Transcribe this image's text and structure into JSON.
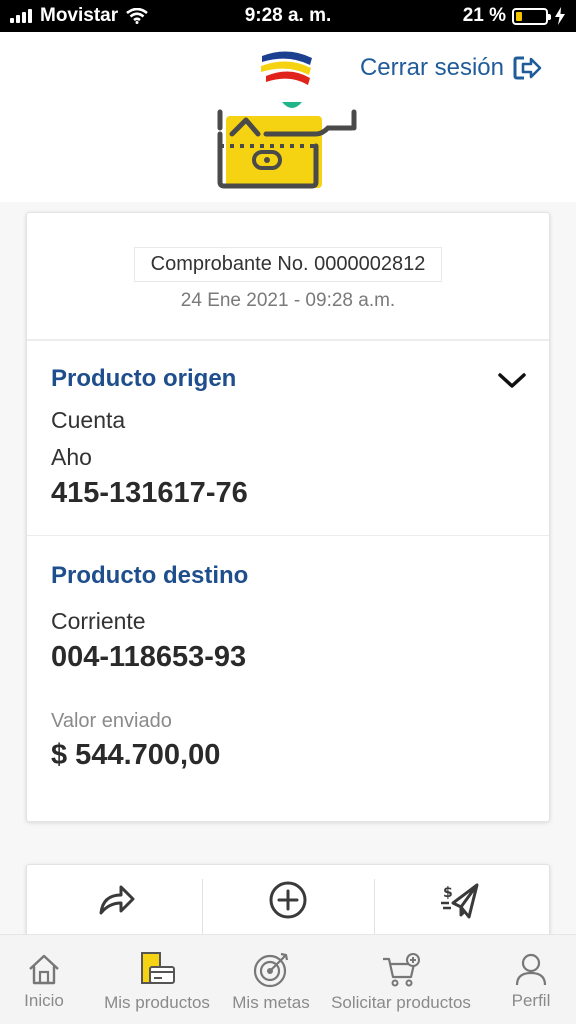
{
  "status_bar": {
    "carrier": "Movistar",
    "time": "9:28 a. m.",
    "battery": "21 %",
    "battery_level": 0.21
  },
  "header": {
    "logout_label": "Cerrar sesión"
  },
  "receipt": {
    "voucher": "Comprobante No. 0000002812",
    "date": "24 Ene 2021 - 09:28 a.m.",
    "origin": {
      "title": "Producto origen",
      "type_line1": "Cuenta",
      "type_line2": "Aho",
      "number": "415-131617-76"
    },
    "destination": {
      "title": "Producto destino",
      "type": "Corriente",
      "number": "004-118653-93"
    },
    "amount_label": "Valor enviado",
    "amount": "$ 544.700,00"
  },
  "actions": [
    {
      "icon": "share-icon"
    },
    {
      "icon": "add-circle-icon"
    },
    {
      "icon": "send-money-icon"
    }
  ],
  "nav": {
    "items": [
      {
        "label": "Inicio",
        "icon": "home-icon"
      },
      {
        "label": "Mis productos",
        "icon": "products-icon"
      },
      {
        "label": "Mis metas",
        "icon": "target-icon"
      },
      {
        "label": "Solicitar productos",
        "icon": "cart-icon"
      },
      {
        "label": "Perfil",
        "icon": "user-icon"
      }
    ]
  },
  "colors": {
    "brand_blue": "#1f4e8c",
    "link_blue": "#1f5c99",
    "accent_yellow": "#f5d313",
    "accent_red": "#e0241b",
    "accent_green": "#1fb58a"
  }
}
